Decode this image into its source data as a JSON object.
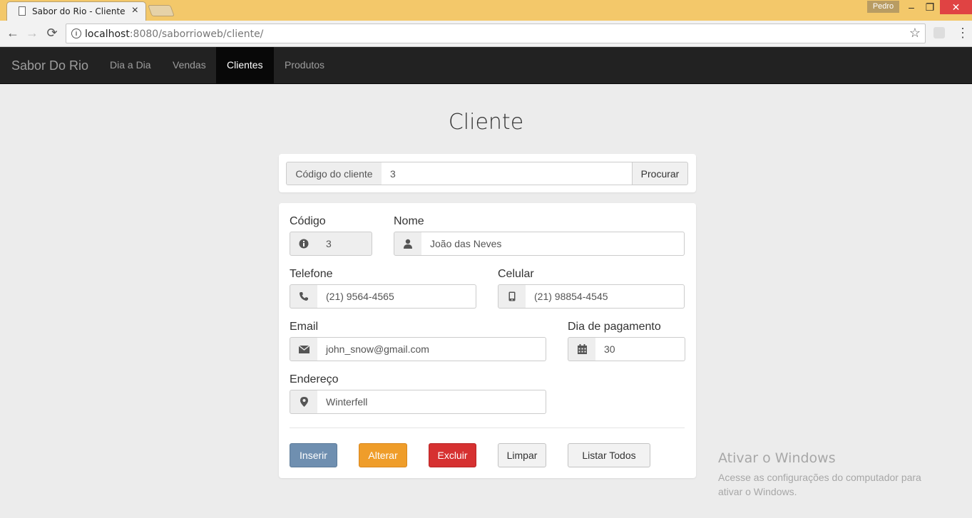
{
  "browser": {
    "tab_title": "Sabor do Rio - Cliente",
    "tab_close": "×",
    "user": "Pedro",
    "url_host": "localhost",
    "url_path": ":8080/saborrioweb/cliente/",
    "win_minimize": "–",
    "win_restore": "❐",
    "win_close": "✕",
    "back": "←",
    "forward": "→",
    "reload": "⟳",
    "star": "☆",
    "menu": "⋮"
  },
  "navbar": {
    "brand": "Sabor Do Rio",
    "items": [
      {
        "label": "Dia a Dia",
        "active": false
      },
      {
        "label": "Vendas",
        "active": false
      },
      {
        "label": "Clientes",
        "active": true
      },
      {
        "label": "Produtos",
        "active": false
      }
    ]
  },
  "page": {
    "title": "Cliente"
  },
  "search": {
    "addon_label": "Código do cliente",
    "value": "3",
    "button": "Procurar"
  },
  "form": {
    "codigo": {
      "label": "Código",
      "value": "3",
      "icon": "info-icon"
    },
    "nome": {
      "label": "Nome",
      "value": "João das Neves",
      "icon": "user-icon"
    },
    "telefone": {
      "label": "Telefone",
      "value": "(21) 9564-4565",
      "icon": "phone-icon"
    },
    "celular": {
      "label": "Celular",
      "value": "(21) 98854-4545",
      "icon": "mobile-icon"
    },
    "email": {
      "label": "Email",
      "value": "john_snow@gmail.com",
      "icon": "envelope-icon"
    },
    "dia_pagamento": {
      "label": "Dia de pagamento",
      "value": "30",
      "icon": "calendar-icon"
    },
    "endereco": {
      "label": "Endereço",
      "value": "Winterfell",
      "icon": "map-marker-icon"
    }
  },
  "actions": {
    "inserir": "Inserir",
    "alterar": "Alterar",
    "excluir": "Excluir",
    "limpar": "Limpar",
    "listar": "Listar Todos"
  },
  "watermark": {
    "title": "Ativar o Windows",
    "text": "Acesse as configurações do computador para ativar o Windows."
  },
  "colors": {
    "navbar": "#222222",
    "primary": "#6f8fb0",
    "warning": "#ef9d2a",
    "danger": "#d63131"
  }
}
